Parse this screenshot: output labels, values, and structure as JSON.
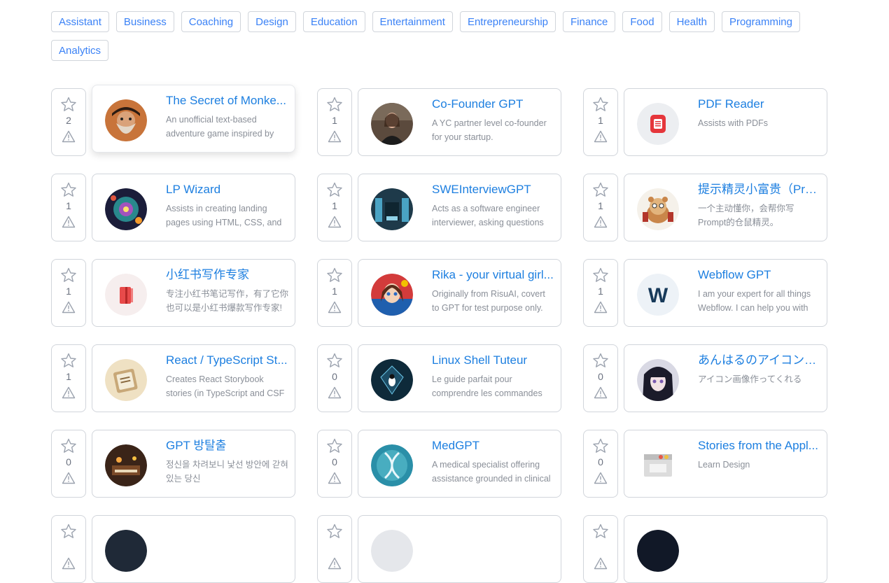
{
  "tags": [
    "Assistant",
    "Business",
    "Coaching",
    "Design",
    "Education",
    "Entertainment",
    "Entrepreneurship",
    "Finance",
    "Food",
    "Health",
    "Programming",
    "Analytics"
  ],
  "cards": [
    {
      "title": "The Secret of Monke...",
      "desc": "An unofficial text-based adventure game inspired by",
      "votes": "2",
      "avatar": "pirate-avatar",
      "raised": true
    },
    {
      "title": "Co-Founder GPT",
      "desc": "A YC partner level co-founder for your startup.",
      "votes": "1",
      "avatar": "woman-portrait-avatar"
    },
    {
      "title": "PDF Reader",
      "desc": "Assists with PDFs",
      "votes": "1",
      "avatar": "pdf-document-avatar"
    },
    {
      "title": "LP Wizard",
      "desc": "Assists in creating landing pages using HTML, CSS, and",
      "votes": "1",
      "avatar": "cosmic-orb-avatar"
    },
    {
      "title": "SWEInterviewGPT",
      "desc": "Acts as a software engineer interviewer, asking questions",
      "votes": "1",
      "avatar": "server-room-avatar"
    },
    {
      "title": "提示精灵小富贵（Pro...",
      "desc": "一个主动懂你，会帮你写Prompt的仓鼠精灵。",
      "votes": "1",
      "avatar": "hamster-avatar"
    },
    {
      "title": "小红书写作专家",
      "desc": "专注小红书笔记写作，有了它你也可以是小红书爆款写作专家!",
      "votes": "1",
      "avatar": "red-book-avatar"
    },
    {
      "title": "Rika - your virtual girl...",
      "desc": "Originally from RisuAI, covert to GPT for test purpose only.",
      "votes": "1",
      "avatar": "anime-girl-avatar"
    },
    {
      "title": "Webflow GPT",
      "desc": "I am your expert for all things Webflow. I can help you with",
      "votes": "1",
      "avatar": "webflow-logo-avatar"
    },
    {
      "title": "React / TypeScript St...",
      "desc": "Creates React Storybook stories (in TypeScript and CSF",
      "votes": "1",
      "avatar": "storybook-avatar"
    },
    {
      "title": "Linux Shell Tuteur",
      "desc": "Le guide parfait pour comprendre les commandes",
      "votes": "0",
      "avatar": "linux-penguin-avatar"
    },
    {
      "title": "あんはるのアイコンジ...",
      "desc": "アイコン画像作ってくれる",
      "votes": "0",
      "avatar": "anime-portrait-avatar"
    },
    {
      "title": "GPT 방탈출",
      "desc": "정신을 차려보니 낯선 방안에 갇혀있는 당신",
      "votes": "0",
      "avatar": "escape-room-avatar"
    },
    {
      "title": "MedGPT",
      "desc": "A medical specialist offering assistance grounded in clinical",
      "votes": "0",
      "avatar": "dna-avatar"
    },
    {
      "title": "Stories from the Appl...",
      "desc": "Learn Design",
      "votes": "0",
      "avatar": "mac-window-avatar"
    },
    {
      "title": "",
      "desc": "",
      "votes": "",
      "avatar": "dark-avatar"
    },
    {
      "title": "",
      "desc": "",
      "votes": "",
      "avatar": "teal-avatar"
    },
    {
      "title": "",
      "desc": "",
      "votes": "",
      "avatar": "dark-avatar-2"
    }
  ]
}
